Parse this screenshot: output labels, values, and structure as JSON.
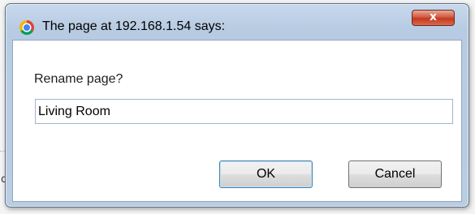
{
  "dialog": {
    "title": "The page at 192.168.1.54 says:",
    "close_label": "x",
    "message": "Rename page?",
    "input_value": "Living Room",
    "ok_label": "OK",
    "cancel_label": "Cancel"
  },
  "background": {
    "partial_char": "o"
  },
  "colors": {
    "titlebar": "#b9cde3",
    "close_button": "#c3391f",
    "ok_border": "#3c7fb1"
  }
}
